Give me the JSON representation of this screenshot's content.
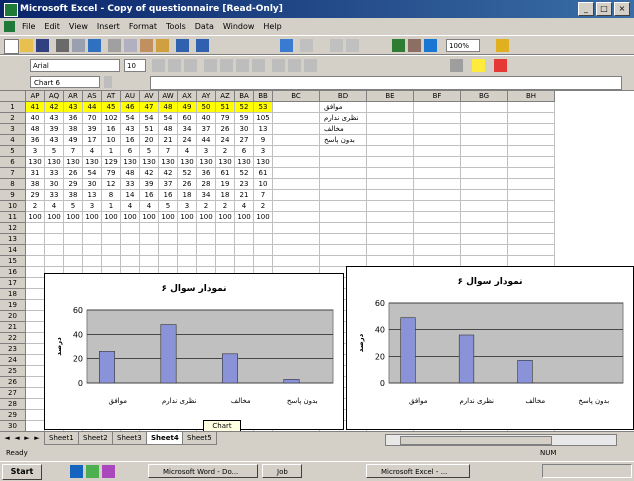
{
  "window": {
    "title": "Microsoft Excel - Copy of questionnaire [Read-Only]",
    "minimize": "_",
    "maximize": "□",
    "close": "×"
  },
  "menu": [
    "File",
    "Edit",
    "View",
    "Insert",
    "Format",
    "Tools",
    "Data",
    "Window",
    "Help"
  ],
  "toolbar": {
    "zoom": "100%",
    "font_name": "Arial",
    "font_size": "10"
  },
  "formula": {
    "name_box": "Chart 6"
  },
  "sheet": {
    "col_headers_left": [
      "AP",
      "AQ",
      "AR",
      "AS",
      "AT",
      "AU",
      "AV",
      "AW",
      "AX",
      "AY",
      "AZ",
      "BA",
      "BB"
    ],
    "col_headers_right": [
      "BC",
      "BD",
      "BE",
      "BF",
      "BG",
      "BH"
    ],
    "row_numbers": [
      "1",
      "2",
      "3",
      "4",
      "5",
      "6",
      "7",
      "8",
      "9",
      "10",
      "11",
      "12",
      "13",
      "14",
      "15",
      "16",
      "17",
      "18",
      "19",
      "20",
      "21",
      "22",
      "23",
      "24",
      "25",
      "26",
      "27",
      "28",
      "29",
      "30"
    ],
    "rows": [
      [
        "41",
        "42",
        "43",
        "44",
        "45",
        "46",
        "47",
        "48",
        "49",
        "50",
        "51",
        "52",
        "53"
      ],
      [
        "40",
        "43",
        "36",
        "70",
        "102",
        "54",
        "54",
        "54",
        "60",
        "40",
        "79",
        "59",
        "105"
      ],
      [
        "48",
        "39",
        "38",
        "39",
        "16",
        "43",
        "51",
        "48",
        "34",
        "37",
        "26",
        "30",
        "13"
      ],
      [
        "36",
        "43",
        "49",
        "17",
        "10",
        "16",
        "20",
        "21",
        "24",
        "44",
        "24",
        "27",
        "9"
      ],
      [
        "3",
        "5",
        "7",
        "4",
        "1",
        "6",
        "5",
        "7",
        "4",
        "3",
        "2",
        "6",
        "3"
      ],
      [
        "130",
        "130",
        "130",
        "130",
        "129",
        "130",
        "130",
        "130",
        "130",
        "130",
        "130",
        "130",
        "130"
      ],
      [
        "31",
        "33",
        "26",
        "54",
        "79",
        "48",
        "42",
        "42",
        "52",
        "36",
        "61",
        "52",
        "61"
      ],
      [
        "38",
        "30",
        "29",
        "30",
        "12",
        "33",
        "39",
        "37",
        "26",
        "28",
        "19",
        "23",
        "10"
      ],
      [
        "29",
        "33",
        "38",
        "13",
        "8",
        "14",
        "16",
        "16",
        "18",
        "34",
        "18",
        "21",
        "7"
      ],
      [
        "2",
        "4",
        "5",
        "3",
        "1",
        "4",
        "4",
        "5",
        "3",
        "2",
        "2",
        "4",
        "2"
      ],
      [
        "100",
        "100",
        "100",
        "100",
        "100",
        "100",
        "100",
        "100",
        "100",
        "100",
        "100",
        "100",
        "100"
      ]
    ],
    "category_labels": [
      "موافق",
      "نظری ندارم",
      "مخالف",
      "بدون پاسخ"
    ]
  },
  "charts": [
    {
      "title": "نمودار سوال ۶",
      "categories": [
        "موافق",
        "نظری ندارم",
        "مخالف",
        "بدون پاسخ"
      ],
      "values": [
        26,
        48,
        24,
        3
      ],
      "ylim": [
        0,
        60
      ],
      "yticks": [
        "0",
        "20",
        "40",
        "60"
      ],
      "ylabel": "درصد"
    },
    {
      "title": "نمودار سوال ۶",
      "categories": [
        "موافق",
        "نظری ندارم",
        "مخالف",
        "بدون پاسخ"
      ],
      "values": [
        49,
        36,
        17,
        0
      ],
      "ylim": [
        0,
        60
      ],
      "yticks": [
        "0",
        "20",
        "40",
        "60"
      ],
      "ylabel": "درصد"
    }
  ],
  "chart_data": [
    {
      "type": "bar",
      "title": "نمودار سوال ۶",
      "categories": [
        "موافق",
        "نظری ندارم",
        "مخالف",
        "بدون پاسخ"
      ],
      "values": [
        26,
        48,
        24,
        3
      ],
      "ylabel": "درصد",
      "ylim": [
        0,
        60
      ],
      "grid": true
    },
    {
      "type": "bar",
      "title": "نمودار سوال ۶",
      "categories": [
        "موافق",
        "نظری ندارم",
        "مخالف",
        "بدون پاسخ"
      ],
      "values": [
        49,
        36,
        17,
        0
      ],
      "ylabel": "درصد",
      "ylim": [
        0,
        60
      ],
      "grid": true
    }
  ],
  "tabs": [
    "Sheet1",
    "Sheet2",
    "Sheet3",
    "Sheet4",
    "Sheet5"
  ],
  "tooltip": "Chart Title",
  "status": {
    "left": "Ready",
    "right": "NUM"
  },
  "taskbar": {
    "start": "Start",
    "buttons": [
      "Microsoft Word - Do...",
      "Job",
      "Microsoft Excel - ..."
    ],
    "clock": ""
  },
  "colors": {
    "bar": "#8a93d8",
    "plot_area": "#c0c0c0",
    "highlight": "#ffff00"
  }
}
